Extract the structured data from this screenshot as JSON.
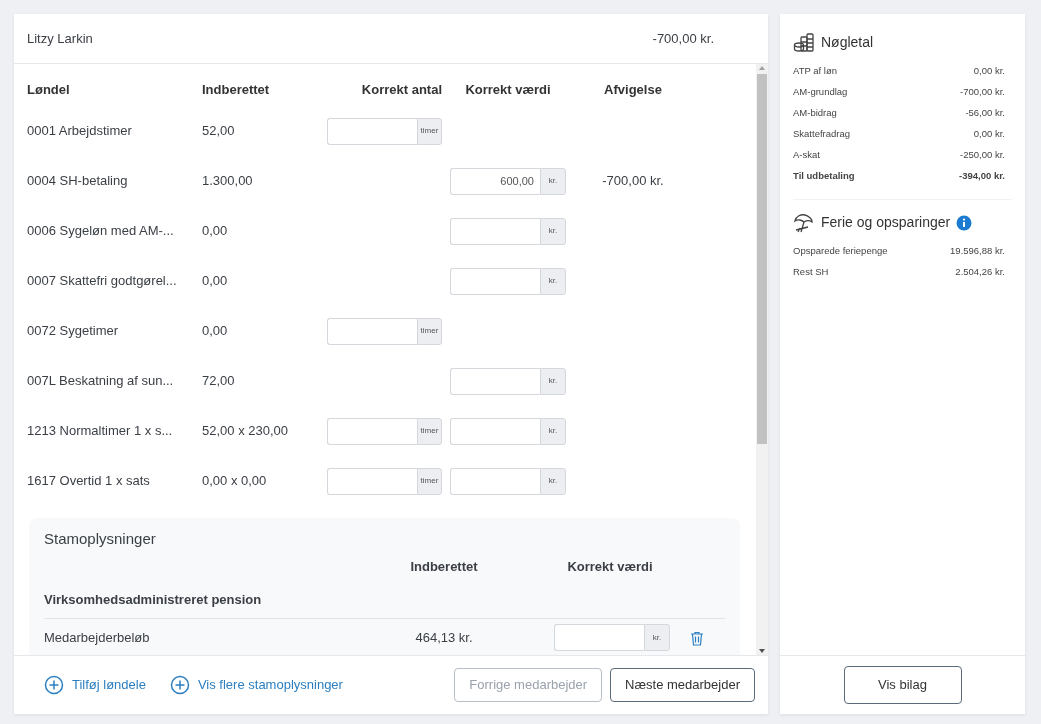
{
  "employee": {
    "name": "Litzy Larkin",
    "amount": "-700,00 kr."
  },
  "columns": [
    "Løndel",
    "Indberettet",
    "Korrekt antal",
    "Korrekt værdi",
    "Afvigelse"
  ],
  "rows": [
    {
      "name": "0001 Arbejdstimer",
      "reported": "52,00",
      "count_field": {
        "unit": "timer"
      },
      "value_field": null
    },
    {
      "name": "0004 SH-betaling",
      "reported": "1.300,00",
      "count_field": null,
      "value_field": {
        "unit": "kr.",
        "value": "600,00"
      },
      "deviation": "-700,00 kr."
    },
    {
      "name": "0006 Sygeløn med AM-...",
      "reported": "0,00",
      "count_field": null,
      "value_field": {
        "unit": "kr."
      }
    },
    {
      "name": "0007 Skattefri godtgørel...",
      "reported": "0,00",
      "count_field": null,
      "value_field": {
        "unit": "kr."
      }
    },
    {
      "name": "0072 Sygetimer",
      "reported": "0,00",
      "count_field": {
        "unit": "timer"
      },
      "value_field": null
    },
    {
      "name": "007L Beskatning af sun...",
      "reported": "72,00",
      "count_field": null,
      "value_field": {
        "unit": "kr."
      }
    },
    {
      "name": "1213 Normaltimer 1 x s...",
      "reported": "52,00 x 230,00",
      "count_field": {
        "unit": "timer"
      },
      "value_field": {
        "unit": "kr."
      }
    },
    {
      "name": "1617 Overtid 1 x sats",
      "reported": "0,00 x 0,00",
      "count_field": {
        "unit": "timer"
      },
      "value_field": {
        "unit": "kr."
      }
    }
  ],
  "master_data": {
    "title": "Stamoplysninger",
    "columns": [
      "Indberettet",
      "Korrekt værdi"
    ],
    "group": "Virksomhedsadministreret pension",
    "rows": [
      {
        "label": "Medarbejderbeløb",
        "reported": "464,13 kr.",
        "unit": "kr."
      }
    ]
  },
  "footer": {
    "links": [
      "Tilføj løndele",
      "Vis flere stamoplysninger"
    ],
    "buttons": [
      {
        "label": "Forrige medarbejder",
        "disabled": true
      },
      {
        "label": "Næste medarbejder",
        "disabled": false
      }
    ]
  },
  "key_figures": {
    "title": "Nøgletal",
    "items": [
      {
        "label": "ATP af løn",
        "value": "0,00 kr.",
        "bold": false
      },
      {
        "label": "AM-grundlag",
        "value": "-700,00 kr.",
        "bold": false
      },
      {
        "label": "AM-bidrag",
        "value": "-56,00 kr.",
        "bold": false
      },
      {
        "label": "Skattefradrag",
        "value": "0,00 kr.",
        "bold": false
      },
      {
        "label": "A-skat",
        "value": "-250,00 kr.",
        "bold": false
      },
      {
        "label": "Til udbetaling",
        "value": "-394,00 kr.",
        "bold": true
      }
    ]
  },
  "savings": {
    "title": "Ferie og opsparinger",
    "items": [
      {
        "label": "Opsparede feriepenge",
        "value": "19.596,88 kr."
      },
      {
        "label": "Rest SH",
        "value": "2.504,26 kr."
      }
    ]
  },
  "attachment_button": "Vis bilag"
}
